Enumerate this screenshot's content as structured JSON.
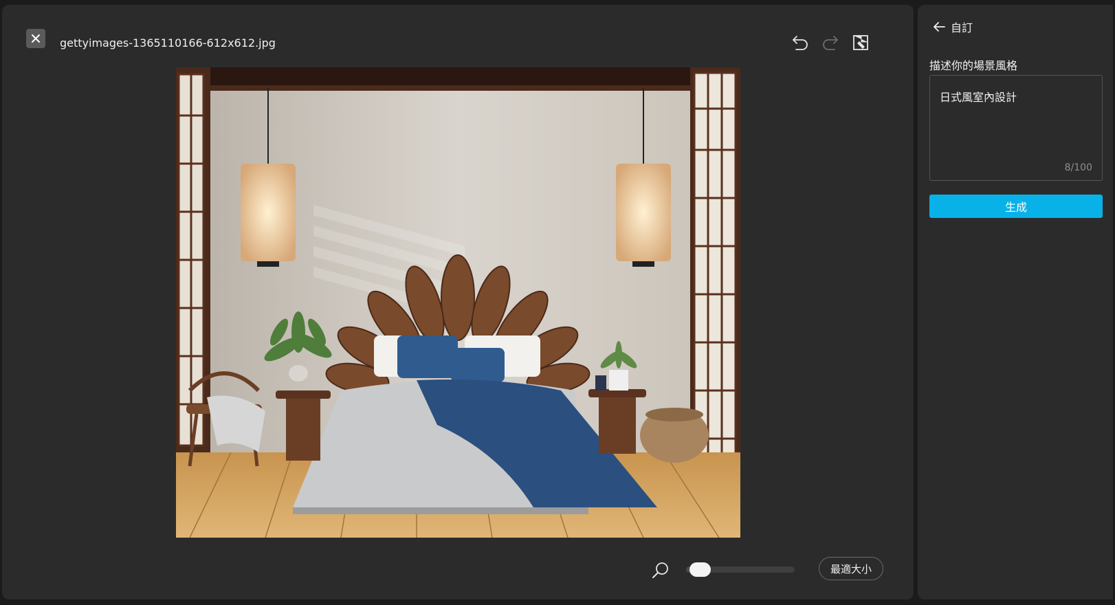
{
  "header": {
    "file_name": "gettyimages-1365110166-612x612.jpg"
  },
  "toolbar": {
    "close_icon": "close-icon",
    "undo_icon": "undo-icon",
    "redo_icon": "redo-icon",
    "erase_icon": "eraser-icon"
  },
  "zoom": {
    "level": 0.05,
    "fit_label": "最適大小"
  },
  "side_panel": {
    "back_label": "自訂",
    "field_label": "描述你的場景風格",
    "prompt_value": "日式風室內設計",
    "char_count": "8/100",
    "generate_label": "生成",
    "accent_color": "#08b2e8"
  }
}
